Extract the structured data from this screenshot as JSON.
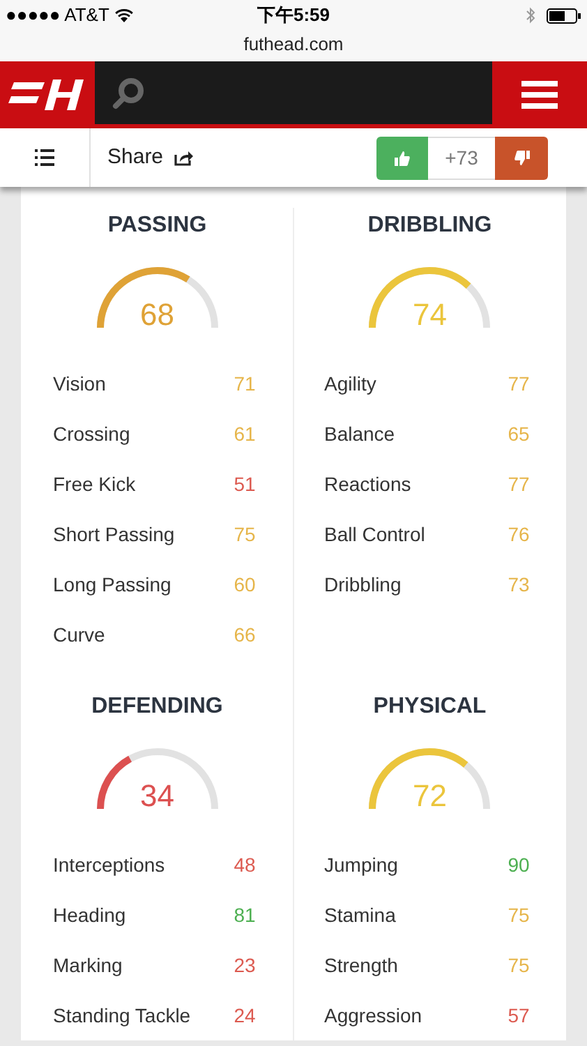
{
  "status_bar": {
    "carrier": "●●●●● AT&T",
    "time": "下午5:59"
  },
  "url": "futhead.com",
  "toolbar": {
    "share": "Share",
    "votes": "+73"
  },
  "sections": [
    {
      "title": "PASSING",
      "rating": "68",
      "color": "#dfa236",
      "stats": [
        {
          "name": "Vision",
          "value": "71",
          "color": "#e6b54a"
        },
        {
          "name": "Crossing",
          "value": "61",
          "color": "#e6b54a"
        },
        {
          "name": "Free Kick",
          "value": "51",
          "color": "#dc5a50"
        },
        {
          "name": "Short Passing",
          "value": "75",
          "color": "#e6b54a"
        },
        {
          "name": "Long Passing",
          "value": "60",
          "color": "#e6b54a"
        },
        {
          "name": "Curve",
          "value": "66",
          "color": "#e6b54a"
        }
      ]
    },
    {
      "title": "DRIBBLING",
      "rating": "74",
      "color": "#ebc53c",
      "stats": [
        {
          "name": "Agility",
          "value": "77",
          "color": "#e6b54a"
        },
        {
          "name": "Balance",
          "value": "65",
          "color": "#e6b54a"
        },
        {
          "name": "Reactions",
          "value": "77",
          "color": "#e6b54a"
        },
        {
          "name": "Ball Control",
          "value": "76",
          "color": "#e6b54a"
        },
        {
          "name": "Dribbling",
          "value": "73",
          "color": "#e6b54a"
        }
      ]
    },
    {
      "title": "DEFENDING",
      "rating": "34",
      "color": "#dc5050",
      "stats": [
        {
          "name": "Interceptions",
          "value": "48",
          "color": "#dc5a50"
        },
        {
          "name": "Heading",
          "value": "81",
          "color": "#4caf50"
        },
        {
          "name": "Marking",
          "value": "23",
          "color": "#dc5a50"
        },
        {
          "name": "Standing Tackle",
          "value": "24",
          "color": "#dc5a50"
        }
      ]
    },
    {
      "title": "PHYSICAL",
      "rating": "72",
      "color": "#ebc53c",
      "stats": [
        {
          "name": "Jumping",
          "value": "90",
          "color": "#4caf50"
        },
        {
          "name": "Stamina",
          "value": "75",
          "color": "#e6b54a"
        },
        {
          "name": "Strength",
          "value": "75",
          "color": "#e6b54a"
        },
        {
          "name": "Aggression",
          "value": "57",
          "color": "#dc5a50"
        }
      ]
    }
  ]
}
